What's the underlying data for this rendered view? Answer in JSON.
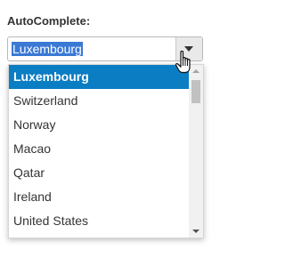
{
  "label": "AutoComplete:",
  "combo": {
    "value": "Luxembourg",
    "button_icon": "caret-down-icon"
  },
  "cursor_icon": "hand-pointer-icon",
  "dropdown": {
    "items": [
      {
        "label": "Luxembourg",
        "selected": true
      },
      {
        "label": "Switzerland",
        "selected": false
      },
      {
        "label": "Norway",
        "selected": false
      },
      {
        "label": "Macao",
        "selected": false
      },
      {
        "label": "Qatar",
        "selected": false
      },
      {
        "label": "Ireland",
        "selected": false
      },
      {
        "label": "United States",
        "selected": false
      }
    ]
  },
  "colors": {
    "selected_item_bg": "#0a7dc3",
    "text_selection_bg": "#3a79d4"
  }
}
